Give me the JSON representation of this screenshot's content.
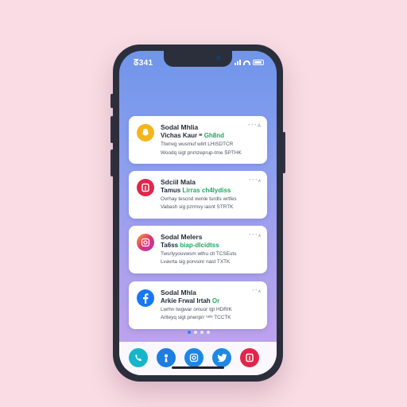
{
  "status_bar": {
    "time": "ᘔ341"
  },
  "notifications": [
    {
      "app_icon": "snapchat-icon",
      "icon_color": "#f2b51c",
      "title": "Sodal Mhlia",
      "meta": "ᐩ ᐪ ᐩ A",
      "subtitle_text": "Vichas Kaur ᶦᵉ ",
      "subtitle_highlight": "Gh8nd",
      "line1": "Ttwnvg wusmuf wilrt LHISDTCR",
      "line2": "Woodq sigt pnmzeprup-tme ՏPTHK"
    },
    {
      "app_icon": "pinterest-icon",
      "icon_color": "#e0264a",
      "title": "Sdciil Mala",
      "meta": "ᐩ ᐩ ᐩ ᴀ",
      "subtitle_text": "Tamus ",
      "subtitle_highlight": "Lirras ch4lydiss",
      "line1": "Ovrhay tescnd xwnle turdls wrtfes",
      "line2": "Vabash sig pzrmvy iasnt STRTK"
    },
    {
      "app_icon": "instagram-icon",
      "icon_color": "#e2336b",
      "title": "Sodal Melers",
      "meta": "ᐩ ᐩ ᐩ ᴀ",
      "subtitle_text": "Ta6ss ",
      "subtitle_highlight": "biap-dlcidtss",
      "line1": "Twsrlyyouvwsm wthu clt TCSEuts",
      "line2": "Lvavrta sig porvsinr nast TXTK"
    },
    {
      "app_icon": "facebook-icon",
      "icon_color": "#1877f2",
      "title": "Sodal Mhla",
      "meta": "ᐩ ᐩ ᴀ",
      "subtitle_text": "Arkie Frwal Irtah ",
      "subtitle_highlight": "Or",
      "line1": "Lwrhn twgwar omuor tgt HDRIK",
      "line2": "Arlteyq sigt pnenprr ᵗᵃᵈˢ TCCTK"
    }
  ],
  "dock": [
    {
      "icon": "phone-icon",
      "color": "#17b5c9"
    },
    {
      "icon": "user-icon",
      "color": "#1f7de0"
    },
    {
      "icon": "instagram-icon",
      "color": "#1f86e6"
    },
    {
      "icon": "twitter-icon",
      "color": "#1e88e5"
    },
    {
      "icon": "pinterest-icon",
      "color": "#e0264a"
    }
  ]
}
